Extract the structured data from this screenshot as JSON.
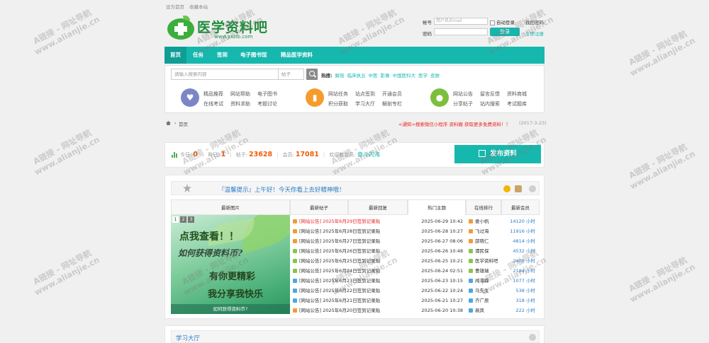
{
  "topbar": {
    "links": [
      "设为首页",
      "收藏本站"
    ]
  },
  "logo": {
    "text": "医学资料吧",
    "sub": "www.yxzlb.com"
  },
  "login": {
    "account_label": "帐号",
    "account_placeholder": "用户名/Email",
    "auto_login": "自动登录",
    "forgot": "找回密码",
    "password_label": "密码",
    "login_button": "登录",
    "register": "立即注册"
  },
  "nav": [
    "首页",
    "任务",
    "签到",
    "电子图书馆",
    "精品医学资料"
  ],
  "search": {
    "placeholder": "请输入搜索内容",
    "type": "帖子",
    "hot_label": "热搜:",
    "hot_keywords": [
      "解剖",
      "临床执业",
      "中医",
      "影像",
      "中国医科大",
      "医学",
      "皮肤"
    ]
  },
  "quick": [
    {
      "icon": "heart-icon",
      "color": "#7d86c5",
      "links": [
        "精品推荐",
        "网站帮助",
        "电子图书",
        "在线考试",
        "资料求助",
        "考题讨论"
      ]
    },
    {
      "icon": "bookmark-icon",
      "color": "#f59c2c",
      "links": [
        "网站任务",
        "站点签到",
        "开通会员",
        "积分获取",
        "学习大厅",
        "解剖专栏"
      ]
    },
    {
      "icon": "chat-icon",
      "color": "#7cbf3e",
      "links": [
        "网站公告",
        "留言反馈",
        "资料商城",
        "分享帖子",
        "站内搜索",
        "考试题库"
      ]
    }
  ],
  "breadcrumb": {
    "home": "首页",
    "notice": "<通知>搜索微信小程序 资料搬 获取更多免费资料！！",
    "date": "(2017-3-23)"
  },
  "stats": {
    "today_label": "今日:",
    "today": "0",
    "yesterday_label": "昨日:",
    "yesterday": "1",
    "posts_label": "帖子:",
    "posts": "23628",
    "members_label": "会员:",
    "members": "17081",
    "welcome_label": "欢迎新会员:",
    "newest": "奋斗的海",
    "post_button": "发布资料"
  },
  "notice_text": "『温馨提示』上午好！今天你看上去好精神哦！",
  "tabs": [
    "最新图片",
    "最新帖子",
    "最新回复",
    "热门主题",
    "在线排行",
    "最新会员"
  ],
  "slider": {
    "pages": [
      "1",
      "2",
      "3"
    ],
    "lines": [
      "点我查看！！",
      "如何获得资料币?",
      "有你更精彩",
      "我分享我快乐"
    ],
    "caption": "如何获得资料币?"
  },
  "posts": [
    {
      "title": "[网站公告] 2025年6月29日签到记录贴",
      "date": "2025-06-29 10:42",
      "color": "#f29b37",
      "red": true
    },
    {
      "title": "[网站公告] 2025年6月28日签到记录贴",
      "date": "2025-06-28 10:27",
      "color": "#f29b37",
      "red": false
    },
    {
      "title": "[网站公告] 2025年6月27日签到记录贴",
      "date": "2025-06-27 08:06",
      "color": "#f29b37",
      "red": false
    },
    {
      "title": "[网站公告] 2025年6月26日签到记录贴",
      "date": "2025-06-26 10:48",
      "color": "#8bc34a",
      "red": false
    },
    {
      "title": "[网站公告] 2025年6月25日签到记录贴",
      "date": "2025-06-25 10:21",
      "color": "#8bc34a",
      "red": false
    },
    {
      "title": "[网站公告] 2025年6月24日签到记录贴",
      "date": "2025-06-24 02:51",
      "color": "#8bc34a",
      "red": false
    },
    {
      "title": "[网站公告] 2025年6月23日签到记录贴",
      "date": "2025-06-23 10:15",
      "color": "#4aa8e0",
      "red": false
    },
    {
      "title": "[网站公告] 2025年6月22日签到记录贴",
      "date": "2025-06-22 10:24",
      "color": "#4aa8e0",
      "red": false
    },
    {
      "title": "[网站公告] 2025年6月21日签到记录贴",
      "date": "2025-06-21 10:27",
      "color": "#4aa8e0",
      "red": false
    },
    {
      "title": "[网站公告] 2025年6月20日签到记录贴",
      "date": "2025-06-20 10:38",
      "color": "#f29b37",
      "red": false
    }
  ],
  "members": [
    {
      "name": "娄小帆",
      "hours": "14120 小时",
      "color": "#f29b37"
    },
    {
      "name": "飞过海",
      "hours": "11916 小时",
      "color": "#f29b37"
    },
    {
      "name": "邵晓仁",
      "hours": "4814 小时",
      "color": "#f29b37"
    },
    {
      "name": "谭民保",
      "hours": "4532 小时",
      "color": "#8bc34a"
    },
    {
      "name": "医学资料吧",
      "hours": "2408 小时",
      "color": "#8bc34a"
    },
    {
      "name": "曹雄瑞",
      "hours": "2184 小时",
      "color": "#8bc34a"
    },
    {
      "name": "闻海霖",
      "hours": "1077 小时",
      "color": "#4aa8e0"
    },
    {
      "name": "马先生",
      "hours": "538 小时",
      "color": "#4aa8e0"
    },
    {
      "name": "齐广辰",
      "hours": "318 小时",
      "color": "#4aa8e0"
    },
    {
      "name": "裴凤",
      "hours": "222 小时",
      "color": "#4aa8e0"
    }
  ],
  "bottom_title": "学习大厅",
  "watermark": {
    "line1": "A链接 - 网址导航",
    "line2": "www.alianjie.cn"
  }
}
